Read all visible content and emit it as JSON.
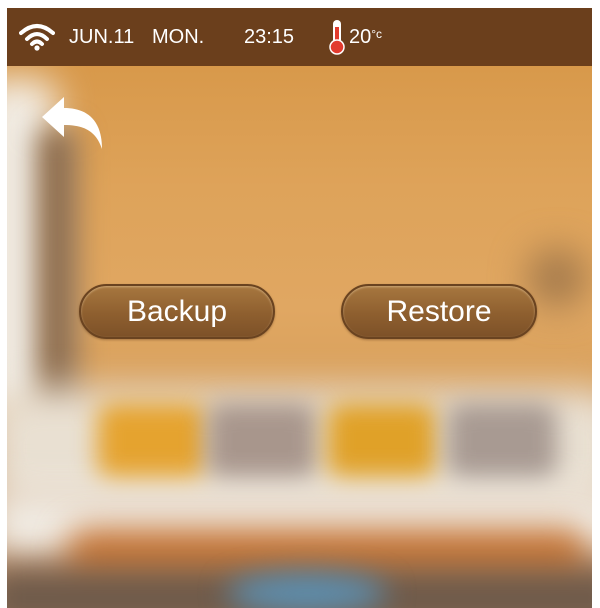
{
  "status_bar": {
    "wifi_icon": "wifi-icon",
    "date": "JUN.11",
    "weekday": "MON.",
    "time": "23:15",
    "thermometer_icon": "thermometer-icon",
    "temperature": "20",
    "temperature_unit": "°c"
  },
  "navigation": {
    "back_icon": "back-arrow-icon"
  },
  "actions": {
    "backup_label": "Backup",
    "restore_label": "Restore"
  },
  "colors": {
    "status_bar_bg": "#6b3f1c",
    "button_bg": "#8e5f2f",
    "wall": "#dea35a"
  }
}
